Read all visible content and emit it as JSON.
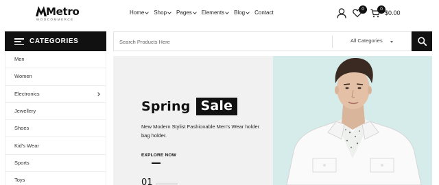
{
  "header": {
    "logo": {
      "word": "Metro",
      "sub": "WOOCOMMERCE"
    },
    "nav": [
      {
        "label": "Home",
        "has_dropdown": true
      },
      {
        "label": "Shop",
        "has_dropdown": true
      },
      {
        "label": "Pages",
        "has_dropdown": true
      },
      {
        "label": "Elements",
        "has_dropdown": true
      },
      {
        "label": "Blog",
        "has_dropdown": true
      },
      {
        "label": "Contact",
        "has_dropdown": false
      }
    ],
    "icons": {
      "user": "user-icon",
      "wishlist": "heart-icon",
      "cart": "cart-icon"
    },
    "wishlist_count": "0",
    "cart_count": "0",
    "cart_total": "$0.00"
  },
  "categories": {
    "title": "CATEGORIES",
    "items": [
      {
        "label": "Men",
        "has_submenu": false
      },
      {
        "label": "Women",
        "has_submenu": false
      },
      {
        "label": "Electronics",
        "has_submenu": true
      },
      {
        "label": "Jewellery",
        "has_submenu": false
      },
      {
        "label": "Shoes",
        "has_submenu": false
      },
      {
        "label": "Kid's Wear",
        "has_submenu": false
      },
      {
        "label": "Sports",
        "has_submenu": false
      },
      {
        "label": "Toys",
        "has_submenu": false
      }
    ]
  },
  "search": {
    "placeholder": "Search Products Here",
    "category_selected": "All Categories"
  },
  "hero": {
    "title_plain": "Spring",
    "title_highlight": "Sale",
    "description": "New Modern Stylist Fashionable Men's Wear holder bag holder.",
    "cta": "EXPLORE NOW",
    "slide_number": "01"
  },
  "colors": {
    "dark": "#111111",
    "hero_left_bg": "#f1f1f1",
    "hero_right_bg": "#d5ecea",
    "border": "#e3e3e3"
  }
}
